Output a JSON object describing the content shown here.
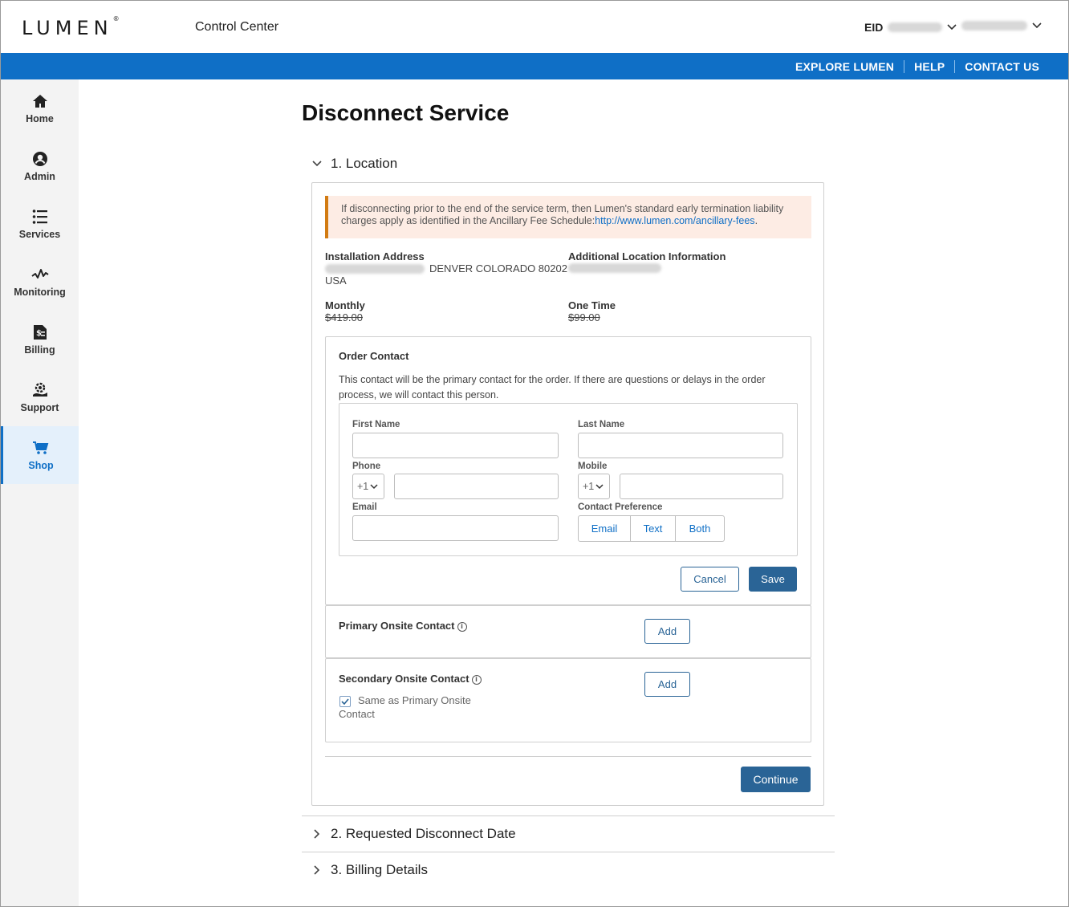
{
  "header": {
    "logo": "LUMEN",
    "logo_mark": "®",
    "app_title": "Control Center",
    "eid_label": "EID"
  },
  "utility_nav": {
    "items": [
      "EXPLORE LUMEN",
      "HELP",
      "CONTACT US"
    ]
  },
  "sidebar": {
    "items": [
      {
        "label": "Home",
        "icon": "home-icon"
      },
      {
        "label": "Admin",
        "icon": "user-icon"
      },
      {
        "label": "Services",
        "icon": "list-icon"
      },
      {
        "label": "Monitoring",
        "icon": "pulse-icon"
      },
      {
        "label": "Billing",
        "icon": "invoice-icon"
      },
      {
        "label": "Support",
        "icon": "support-icon"
      },
      {
        "label": "Shop",
        "icon": "cart-icon",
        "active": true
      }
    ]
  },
  "page": {
    "title": "Disconnect Service"
  },
  "sections": [
    {
      "label": "1. Location",
      "expanded": true
    },
    {
      "label": "2. Requested Disconnect Date",
      "expanded": false
    },
    {
      "label": "3. Billing Details",
      "expanded": false
    }
  ],
  "location": {
    "notice_text": "If disconnecting prior to the end of the service term, then Lumen's standard early termination liability charges apply as identified in the Ancillary Fee Schedule:",
    "notice_link": "http://www.lumen.com/ancillary-fees",
    "notice_end": ".",
    "install_address_label": "Installation Address",
    "install_address_city": "DENVER COLORADO 80202",
    "install_address_country": "USA",
    "additional_info_label": "Additional Location Information",
    "monthly_label": "Monthly",
    "monthly_value": "$419.00",
    "one_time_label": "One Time",
    "one_time_value": "$99.00"
  },
  "order_contact": {
    "title": "Order Contact",
    "description": "This contact will be the primary contact for the order. If there are questions or delays in the order process, we will contact this person.",
    "first_name_label": "First Name",
    "last_name_label": "Last Name",
    "phone_label": "Phone",
    "phone_code": "+1",
    "mobile_label": "Mobile",
    "mobile_code": "+1",
    "email_label": "Email",
    "contact_pref_label": "Contact Preference",
    "pref_options": [
      "Email",
      "Text",
      "Both"
    ],
    "cancel_label": "Cancel",
    "save_label": "Save"
  },
  "primary_onsite": {
    "title": "Primary Onsite Contact",
    "add_label": "Add"
  },
  "secondary_onsite": {
    "title": "Secondary Onsite Contact",
    "add_label": "Add",
    "same_as_label_line1": "Same as Primary Onsite",
    "same_as_label_line2": "Contact",
    "same_as_checked": true
  },
  "continue_label": "Continue",
  "colors": {
    "brand_blue": "#0f6fc6",
    "button_blue": "#2a6496",
    "notice_bg": "#fdece4",
    "notice_border": "#d27b12"
  }
}
